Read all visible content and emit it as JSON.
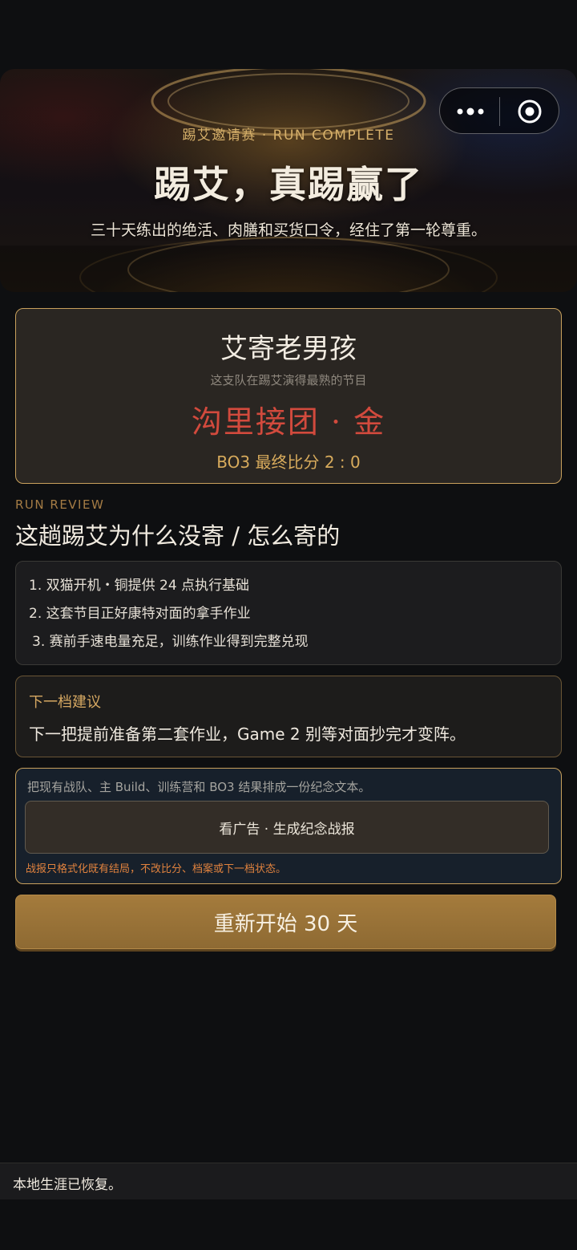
{
  "hero": {
    "subtitle": "踢艾邀请赛 · RUN COMPLETE",
    "title": "踢艾，真踢赢了",
    "description": "三十天练出的绝活、肉膳和买货口令，经住了第一轮尊重。"
  },
  "capsule": {
    "more_icon": "more-dots-icon",
    "close_icon": "target-circle-icon"
  },
  "result": {
    "team_name": "艾寄老男孩",
    "caption": "这支队在踢艾演得最熟的节目",
    "program_medal": "沟里接团 · 金",
    "final_score": "BO3 最终比分 2 : 0"
  },
  "review": {
    "label": "RUN REVIEW",
    "title": "这趟踢艾为什么没寄 / 怎么寄的",
    "reasons": [
      "1. 双猫开机・铜提供 24 点执行基础",
      "2. 这套节目正好康特对面的拿手作业",
      "3. 赛前手速电量充足，训练作业得到完整兑现"
    ]
  },
  "advice": {
    "label": "下一档建议",
    "text": "下一把提前准备第二套作业，Game 2 别等对面抄完才变阵。"
  },
  "report": {
    "description": "把现有战队、主 Build、训练营和 BO3 结果排成一份纪念文本。",
    "button_label": "看广告 · 生成纪念战报",
    "note": "战报只格式化既有结局，不改比分、档案或下一档状态。"
  },
  "restart_label": "重新开始 30 天",
  "toast": "本地生涯已恢复。",
  "colors": {
    "accent_gold": "#c9a15d",
    "medal_red": "#d24a3d",
    "note_orange": "#e0823e",
    "restart_bg": "#a47b3c"
  }
}
